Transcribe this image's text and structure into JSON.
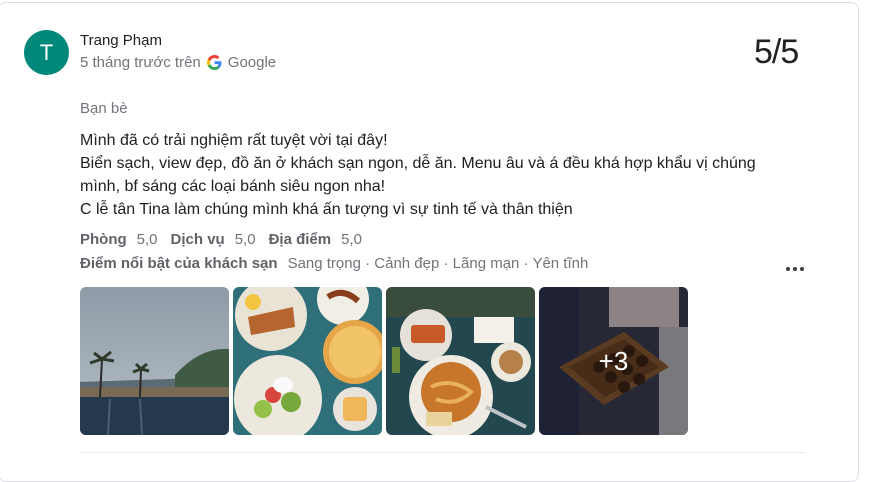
{
  "review": {
    "avatar_letter": "T",
    "author": "Trang Phạm",
    "time_source": "5 tháng trước trên",
    "source": "Google",
    "score": "5/5",
    "relation": "Bạn bè",
    "text_lines": [
      "Mình đã có trải nghiệm rất tuyệt vời tại đây!",
      "Biển sạch, view đẹp, đồ ăn ở khách sạn ngon, dễ ăn. Menu âu và á đều khá hợp khẩu vị chúng",
      "mình, bf sáng các loại bánh siêu ngon nha!",
      "C lễ tân Tina làm chúng mình khá ấn tượng vì sự tinh tế và thân thiện"
    ],
    "sub_ratings": [
      {
        "label": "Phòng",
        "value": "5,0"
      },
      {
        "label": "Dịch vụ",
        "value": "5,0"
      },
      {
        "label": "Địa điểm",
        "value": "5,0"
      }
    ],
    "highlights_label": "Điểm nổi bật của khách sạn",
    "highlights": "Sang trọng · Cảnh đẹp · Lãng mạn · Yên tĩnh",
    "more_photos": "+3",
    "colors": {
      "avatar": "#00897b"
    }
  },
  "icons": [
    "google-g-icon",
    "more-vert-icon"
  ]
}
